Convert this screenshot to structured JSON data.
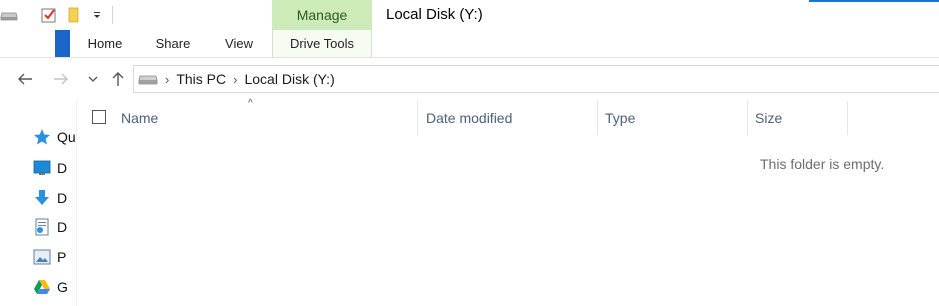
{
  "window": {
    "title": "Local Disk (Y:)",
    "context_tab_group": "Manage"
  },
  "quick_access_toolbar": {
    "icons": [
      "drive-icon",
      "properties-check-icon",
      "new-folder-icon",
      "customize-dropdown-icon"
    ]
  },
  "ribbon": {
    "tabs": [
      {
        "label": "Home"
      },
      {
        "label": "Share"
      },
      {
        "label": "View"
      },
      {
        "label": "Drive Tools"
      }
    ]
  },
  "address_bar": {
    "crumbs": [
      "This PC",
      "Local Disk (Y:)"
    ]
  },
  "nav_pane": {
    "items": [
      {
        "label": "Qu",
        "icon": "quick-access-star-icon"
      },
      {
        "label": "D",
        "icon": "desktop-icon"
      },
      {
        "label": "D",
        "icon": "downloads-icon"
      },
      {
        "label": "D",
        "icon": "documents-icon"
      },
      {
        "label": "P",
        "icon": "pictures-icon"
      },
      {
        "label": "G",
        "icon": "google-drive-icon"
      }
    ]
  },
  "file_list": {
    "columns": [
      "Name",
      "Date modified",
      "Type",
      "Size"
    ],
    "sort_indicator": "^",
    "empty_message": "This folder is empty."
  },
  "colors": {
    "accent_blue": "#1b64c8",
    "manage_green": "#ccebb8"
  }
}
